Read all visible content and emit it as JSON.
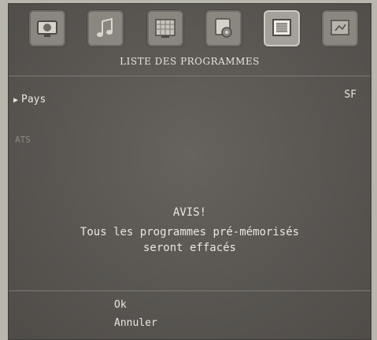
{
  "header": {
    "icons": [
      "tv-image-icon",
      "music-note-icon",
      "grid-picture-icon",
      "gear-settings-icon",
      "programme-list-icon",
      "extras-icon"
    ],
    "active_index": 4
  },
  "menu": {
    "title": "LISTE DES PROGRAMMES"
  },
  "settings": {
    "country_label": "Pays",
    "country_value": "SF",
    "faint_text": "ATS"
  },
  "notice": {
    "title": "AVIS!",
    "line1": "Tous les programmes pré-mémorisés",
    "line2": "seront effacés"
  },
  "options": {
    "ok": "Ok",
    "cancel": "Annuler"
  }
}
